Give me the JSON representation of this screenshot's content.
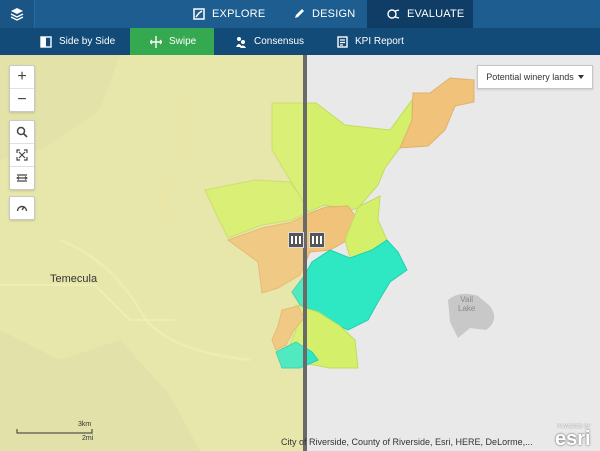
{
  "nav": {
    "tabs": [
      {
        "label": "EXPLORE",
        "icon": "explore-icon"
      },
      {
        "label": "DESIGN",
        "icon": "pencil-icon"
      },
      {
        "label": "EVALUATE",
        "icon": "evaluate-icon",
        "active": true
      }
    ],
    "subtabs": [
      {
        "label": "Side by Side",
        "icon": "side-by-side-icon"
      },
      {
        "label": "Swipe",
        "icon": "swipe-icon",
        "active": true
      },
      {
        "label": "Consensus",
        "icon": "consensus-icon"
      },
      {
        "label": "KPI Report",
        "icon": "kpi-report-icon"
      }
    ]
  },
  "map": {
    "layer_select": "Potential winery lands",
    "labels": {
      "temecula": "Temecula",
      "vail_lake": "Vail\nLake"
    },
    "attribution": "City of Riverside, County of Riverside, Esri, HERE, DeLorme,...",
    "scale": {
      "km": "3km",
      "mi": "2mi"
    },
    "powered_by": "POWERED BY",
    "esri": "esri"
  },
  "colors": {
    "topbar": "#1d5d8f",
    "subbar": "#124a78",
    "active_subtab": "#35a94f",
    "zone_lime": "#d4f06a",
    "zone_orange": "#f0c27a",
    "zone_teal": "#2ee8c4"
  }
}
